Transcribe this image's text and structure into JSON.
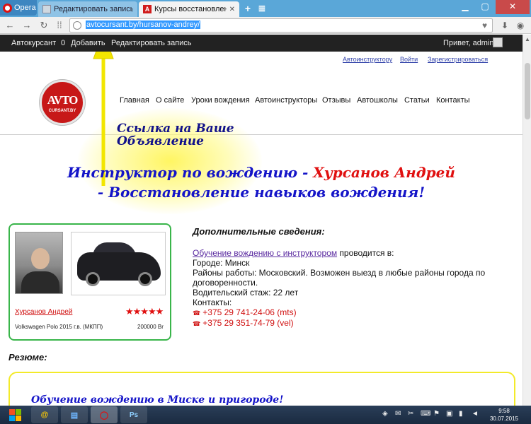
{
  "browser": {
    "opera_label": "Opera",
    "tabs": [
      {
        "label": "Редактировать запись ‹ Ав"
      },
      {
        "label": "Курсы восстановления на"
      }
    ],
    "url": "avtocursant.by/hursanov-andrey/"
  },
  "adminbar": {
    "site": "Автокурсант",
    "comments_count": "0",
    "add": "Добавить",
    "edit": "Редактировать запись",
    "greeting": "Привет, admin"
  },
  "page": {
    "toplinks": [
      "Автоинструктору",
      "Войти",
      "Зарегистрироваться"
    ],
    "logo_main": "AVTO",
    "logo_sub": "CURSANT.BY",
    "nav": [
      "Главная",
      "О сайте",
      "Уроки вождения",
      "Автоинструкторы",
      "Отзывы",
      "Автошколы",
      "Статьи",
      "Контакты"
    ],
    "annotation": [
      "Ссылка на Ваше",
      "Объявление"
    ],
    "headline1_blue": "Инструктор по вождению - ",
    "headline1_red": "Хурсанов Андрей",
    "headline2": "- Восстановление навыков вождения!",
    "card": {
      "name": "Хурсанов Андрей",
      "stars": "★★★★★",
      "rating": 5,
      "car": "Volkswagen Polo 2015 г.в.   (МКПП)",
      "price": "200000 Br"
    },
    "details": {
      "title": "Дополнительные сведения:",
      "link_text": "Обучение вождению с инструктором",
      "link_rest": " проводится в:",
      "city": "Городе: Минск",
      "districts": "Районы работы: Московский. Возможен выезд в любые районы города по договоренности.",
      "experience": "Водительский стаж: 22 лет",
      "contacts_label": "Контакты:",
      "phones": [
        "+375 29 741-24-06 (mts)",
        "+375 29 351-74-79 (vel)"
      ]
    },
    "resume_label": "Резюме:",
    "resume_text": "Обучение вождению в  Миске и  пригороде!"
  },
  "taskbar": {
    "clock_time": "9:58",
    "clock_date": "30.07.2015"
  },
  "colors": {
    "accent_blue": "#1414c8",
    "accent_red": "#e01010",
    "card_border": "#39b54a",
    "resume_border": "#f3ea2a"
  }
}
